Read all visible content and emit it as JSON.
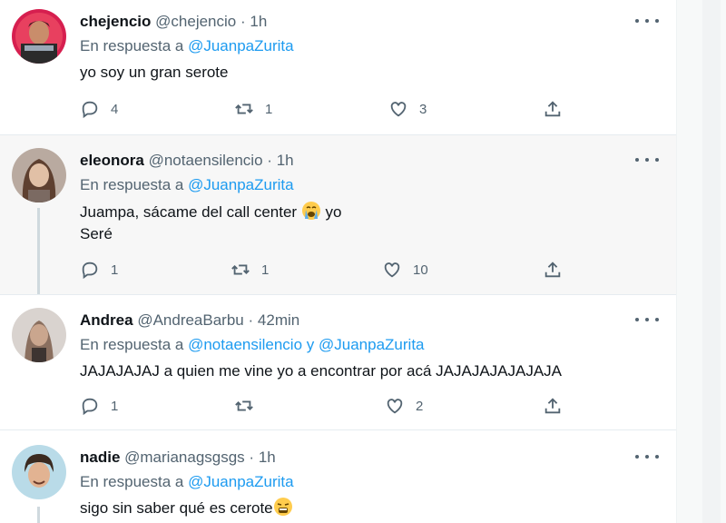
{
  "tweets": [
    {
      "name": "chejencio",
      "handle": "@chejencio",
      "dot": "·",
      "time": "1h",
      "reply_prefix": "En respuesta a",
      "mentions": [
        "@JuanpaZurita"
      ],
      "mention_joiner": "",
      "lines": [
        "yo soy un gran serote"
      ],
      "replies": "4",
      "retweets": "1",
      "likes": "3"
    },
    {
      "name": "eleonora",
      "handle": "@notaensilencio",
      "dot": "·",
      "time": "1h",
      "reply_prefix": "En respuesta a",
      "mentions": [
        "@JuanpaZurita"
      ],
      "mention_joiner": "",
      "lines": [
        "Juampa, sácame del call center",
        "yo",
        "Seré"
      ],
      "replies": "1",
      "retweets": "1",
      "likes": "10"
    },
    {
      "name": "Andrea",
      "handle": "@AndreaBarbu",
      "dot": "·",
      "time": "42min",
      "reply_prefix": "En respuesta a",
      "mentions": [
        "@notaensilencio",
        "@JuanpaZurita"
      ],
      "mention_joiner": "y",
      "lines": [
        "JAJAJAJAJ a quien me vine yo a encontrar por acá JAJAJAJAJAJAJA"
      ],
      "replies": "1",
      "retweets": "",
      "likes": "2"
    },
    {
      "name": "nadie",
      "handle": "@marianagsgsgs",
      "dot": "·",
      "time": "1h",
      "reply_prefix": "En respuesta a",
      "mentions": [
        "@JuanpaZurita"
      ],
      "mention_joiner": "",
      "lines": [
        "sigo sin saber qué es cerote"
      ]
    }
  ],
  "icons": {
    "reply": "reply-icon",
    "retweet": "retweet-icon",
    "like": "heart-icon",
    "share": "share-icon",
    "more": "more-icon"
  },
  "colors": {
    "link": "#1d9bf0",
    "muted": "#536471",
    "text": "#0f1419",
    "highlight_bg": "#f7f7f7"
  }
}
